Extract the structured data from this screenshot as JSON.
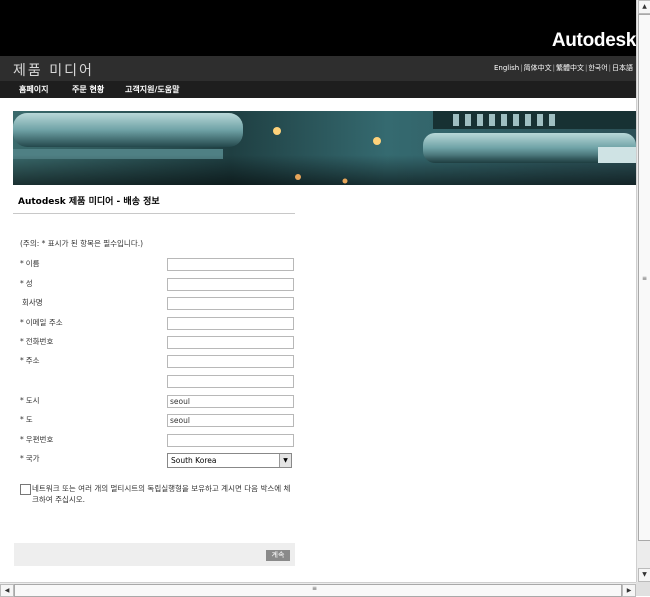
{
  "brand": {
    "logo": "Autodesk"
  },
  "header": {
    "site_title": "제품 미디어",
    "languages": [
      "English",
      "简体中文",
      "繁體中文",
      "한국어",
      "日本語"
    ]
  },
  "nav": {
    "items": [
      "홈페이지",
      "주문 현황",
      "고객지원/도움말"
    ]
  },
  "form": {
    "heading": "Autodesk 제품 미디어 - 배송 정보",
    "required_note": "(주의: * 표시가 된 항목은 필수입니다.)",
    "fields": [
      {
        "label": "이름",
        "required": "*",
        "value": ""
      },
      {
        "label": "성",
        "required": "*",
        "value": ""
      },
      {
        "label": "회사명",
        "required": "",
        "value": ""
      },
      {
        "label": "이메일 주소",
        "required": "*",
        "value": ""
      },
      {
        "label": "전화번호",
        "required": "*",
        "value": ""
      },
      {
        "label": "주소",
        "required": "*",
        "value": ""
      },
      {
        "label": "",
        "required": "",
        "value": ""
      },
      {
        "label": "도시",
        "required": "*",
        "value": "seoul"
      },
      {
        "label": "도",
        "required": "*",
        "value": "seoul"
      },
      {
        "label": "우편번호",
        "required": "*",
        "value": ""
      }
    ],
    "country": {
      "label": "국가",
      "required": "*",
      "value": "South Korea"
    },
    "checkbox_text": "네트워크 또는 여러 개의 멀티시트의 독립실행형을 보유하고 계시면 다음 박스에 체크하여 주십시오.",
    "continue_label": "계속"
  },
  "icons": {
    "scroll_up": "▲",
    "scroll_down": "▼",
    "scroll_left": "◀",
    "scroll_right": "▶",
    "select_arrow": "▼",
    "grip": "≡"
  }
}
